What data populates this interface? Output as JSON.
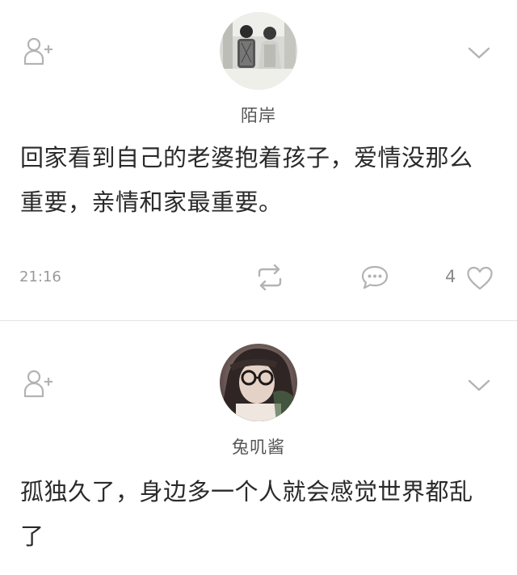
{
  "posts": [
    {
      "username": "陌岸",
      "content_line1": "回家看到自己的老婆抱着孩子，爱情没那么",
      "content_line2": "重要，亲情和家最重要。",
      "time": "21:16",
      "like_count": "4"
    },
    {
      "username": "兔叽酱",
      "content_line1": "孤独久了，身边多一个人就会感觉世界都乱",
      "content_line2": "了"
    }
  ],
  "icons": {
    "follow": "add-user-icon",
    "more": "chevron-down-icon",
    "repost": "repost-icon",
    "comment": "comment-icon",
    "like": "heart-icon"
  },
  "colors": {
    "icon": "#b3b3b3",
    "text": "#2a2a2a",
    "muted": "#9a9a9a",
    "divider": "#e3e3e3"
  }
}
